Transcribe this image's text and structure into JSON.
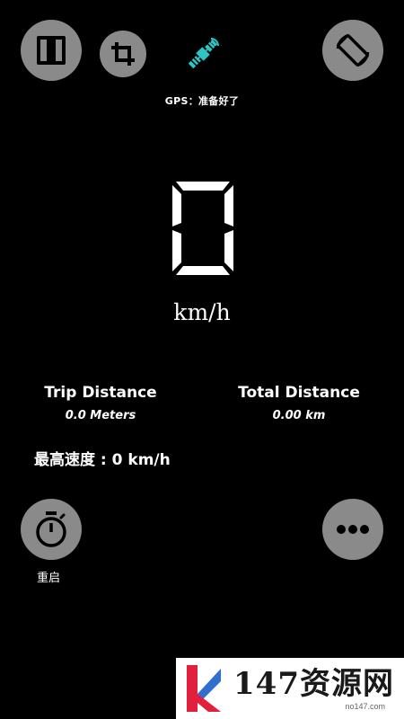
{
  "gps": {
    "status": "GPS：准备好了"
  },
  "speed": {
    "value": "0",
    "unit": "km/h"
  },
  "trip": {
    "label": "Trip Distance",
    "value": "0.0 Meters"
  },
  "total": {
    "label": "Total Distance",
    "value": "0.00 km"
  },
  "max_speed": {
    "text": "最高速度 : 0 km/h"
  },
  "restart": {
    "label": "重启"
  },
  "watermark": {
    "brand": "147资源网",
    "url": "no147.com"
  },
  "colors": {
    "button": "#8a8a8a",
    "satellite": "#2ec4c4",
    "background": "#000000",
    "logo_red": "#e0203c",
    "logo_blue": "#2f6fd0"
  },
  "icons": [
    "columns-icon",
    "crop-icon",
    "satellite-icon",
    "screen-rotation-icon",
    "stopwatch-icon",
    "more-icon"
  ]
}
